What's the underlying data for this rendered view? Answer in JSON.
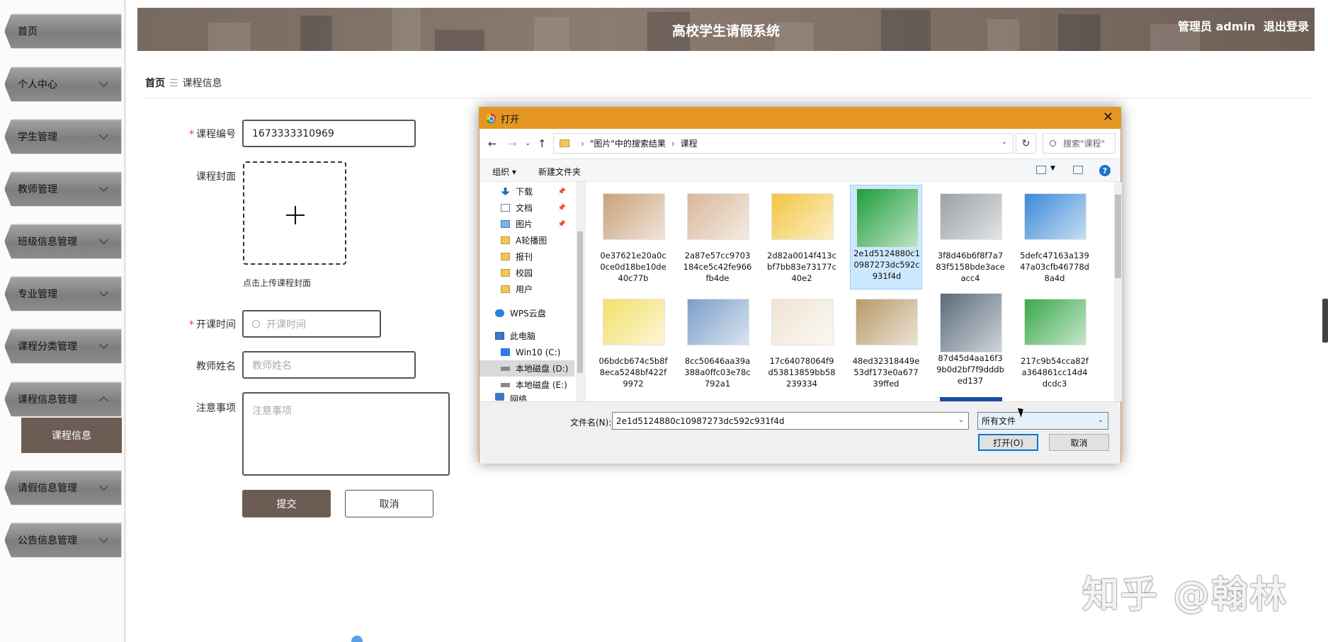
{
  "app": {
    "title": "高校学生请假系统",
    "user_label": "管理员 admin",
    "logout": "退出登录"
  },
  "sidebar": {
    "items": [
      {
        "label": "首页",
        "expandable": false
      },
      {
        "label": "个人中心",
        "expandable": true
      },
      {
        "label": "学生管理",
        "expandable": true
      },
      {
        "label": "教师管理",
        "expandable": true
      },
      {
        "label": "班级信息管理",
        "expandable": true
      },
      {
        "label": "专业管理",
        "expandable": true
      },
      {
        "label": "课程分类管理",
        "expandable": true
      },
      {
        "label": "课程信息管理",
        "expandable": true,
        "expanded": true
      },
      {
        "label": "请假信息管理",
        "expandable": true
      },
      {
        "label": "公告信息管理",
        "expandable": true
      }
    ],
    "subitem": "课程信息"
  },
  "breadcrumb": {
    "home": "首页",
    "separator": "☰",
    "current": "课程信息"
  },
  "form": {
    "course_no": {
      "label": "课程编号",
      "value": "1673333310969"
    },
    "cover": {
      "label": "课程封面",
      "hint": "点击上传课程封面"
    },
    "start_time": {
      "label": "开课时间",
      "placeholder": "开课时间"
    },
    "teacher": {
      "label": "教师姓名",
      "placeholder": "教师姓名"
    },
    "notes": {
      "label": "注意事项",
      "placeholder": "注意事项"
    },
    "submit": "提交",
    "cancel": "取消"
  },
  "dialog": {
    "title": "打开",
    "close": "✕",
    "path": [
      "\"图片\"中的搜索结果",
      "课程"
    ],
    "search_placeholder": "搜索\"课程\"",
    "toolbar": {
      "organize": "组织 ▾",
      "new_folder": "新建文件夹"
    },
    "nav_items": [
      {
        "label": "下载",
        "icon": "download-icon",
        "pinned": true
      },
      {
        "label": "文档",
        "icon": "document-icon",
        "pinned": true
      },
      {
        "label": "图片",
        "icon": "picture-icon",
        "pinned": true
      },
      {
        "label": "A轮播图",
        "icon": "folder-icon"
      },
      {
        "label": "报刊",
        "icon": "folder-icon"
      },
      {
        "label": "校园",
        "icon": "folder-icon"
      },
      {
        "label": "用户",
        "icon": "folder-icon"
      },
      {
        "label": "WPS云盘",
        "icon": "cloud-icon"
      },
      {
        "label": "此电脑",
        "icon": "computer-icon"
      },
      {
        "label": "Win10 (C:)",
        "icon": "windows-drive-icon"
      },
      {
        "label": "本地磁盘 (D:)",
        "icon": "drive-icon",
        "selected": true
      },
      {
        "label": "本地磁盘 (E:)",
        "icon": "drive-icon"
      },
      {
        "label": "网络",
        "icon": "network-icon"
      }
    ],
    "files": [
      {
        "name": "0e37621e20a0c0ce0d18be10de40c77b",
        "color": "#c9a27a"
      },
      {
        "name": "2a87e57cc9703184ce5c42fe966fb4de",
        "color": "#d8b89a"
      },
      {
        "name": "2d82a0014f413cbf7bb83e73177c40e2",
        "color": "#f2c640"
      },
      {
        "name": "2e1d5124880c10987273dc592c931f4d",
        "color": "#1e9e3c",
        "selected": true
      },
      {
        "name": "3f8d46b6f8f7a783f5158bde3aceacc4",
        "color": "#9aa1a6"
      },
      {
        "name": "5defc47163a13947a03cfb46778d8a4d",
        "color": "#3a8ad6"
      },
      {
        "name": "06bdcb674c5b8f8eca5248bf422f9972",
        "color": "#f2e06a"
      },
      {
        "name": "8cc50646aa39a388a0ffc03e78c792a1",
        "color": "#7a9fc8"
      },
      {
        "name": "17c64078064f9d53813859bb58239334",
        "color": "#efe4d4"
      },
      {
        "name": "48ed32318449e53df173e0a67739ffed",
        "color": "#b89a6a"
      },
      {
        "name": "87d45d4aa16f39b0d2bf7f9dddbed137",
        "color": "#5a6a7a"
      },
      {
        "name": "217c9b54cca82fa364861cc14d4dcdc3",
        "color": "#3aa84a"
      }
    ],
    "filename_label": "文件名(N):",
    "filename_value": "2e1d5124880c10987273dc592c931f4d",
    "filetype": "所有文件",
    "open": "打开(O)",
    "cancel": "取消"
  },
  "watermark": "知乎 @翰林"
}
